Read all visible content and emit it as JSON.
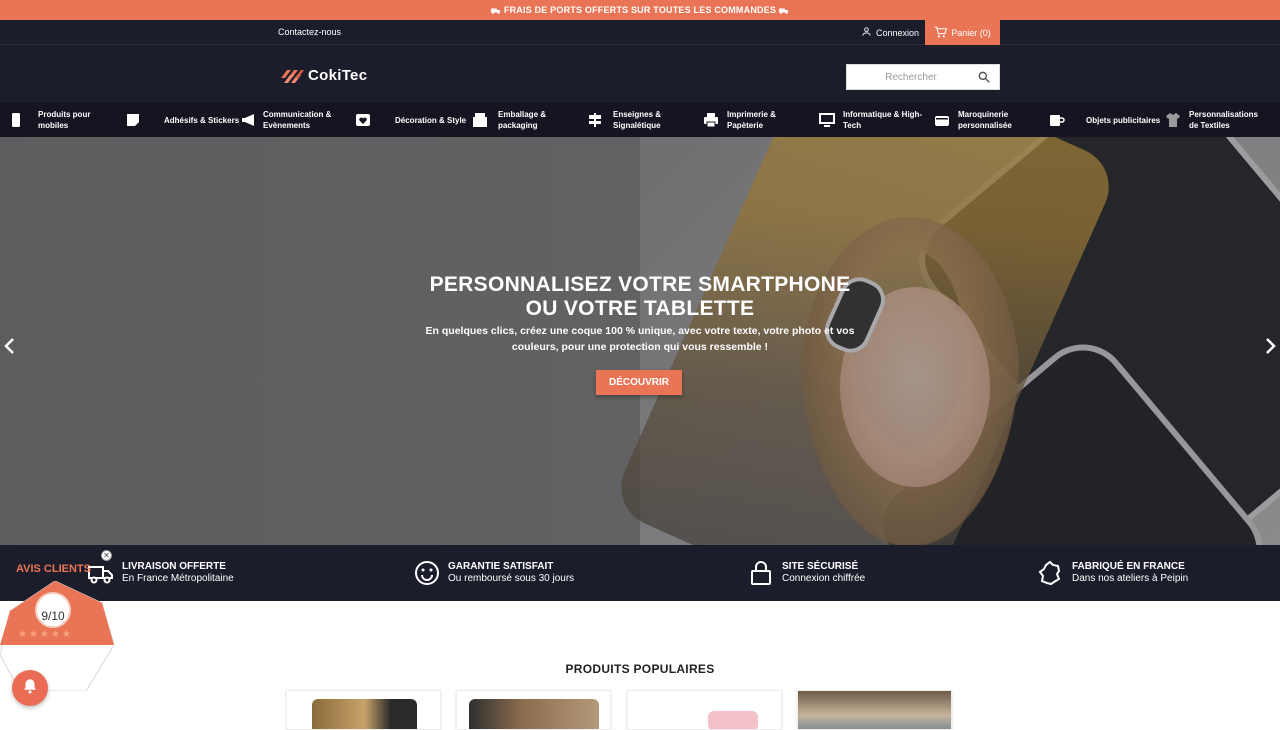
{
  "promo": {
    "text": "FRAIS DE PORTS OFFERTS SUR TOUTES LES COMMANDES"
  },
  "topbar": {
    "contact": "Contactez-nous",
    "login": "Connexion",
    "cart": "Panier (0)"
  },
  "header": {
    "logo_text": "CokiTec",
    "search_placeholder": "Rechercher"
  },
  "nav": {
    "items": [
      {
        "label": "Produits pour mobiles",
        "icon": "phone-icon"
      },
      {
        "label": "Adhésifs & Stickers",
        "icon": "sticker-icon"
      },
      {
        "label": "Communication & Evènements",
        "icon": "megaphone-icon"
      },
      {
        "label": "Décoration & Style",
        "icon": "heart-icon"
      },
      {
        "label": "Emballage & packaging",
        "icon": "box-icon"
      },
      {
        "label": "Enseignes & Signalétique",
        "icon": "signpost-icon"
      },
      {
        "label": "Imprimerie & Papèterie",
        "icon": "printer-icon"
      },
      {
        "label": "Informatique & High-Tech",
        "icon": "monitor-icon"
      },
      {
        "label": "Maroquinerie personnalisée",
        "icon": "wallet-icon"
      },
      {
        "label": "Objets publicitaires",
        "icon": "mug-icon"
      },
      {
        "label": "Personnalisations de Textiles",
        "icon": "tshirt-icon"
      }
    ]
  },
  "hero": {
    "title_line1": "PERSONNALISEZ VOTRE SMARTPHONE",
    "title_line2": "OU VOTRE TABLETTE",
    "text": "En quelques clics, créez une coque 100 % unique, avec votre texte, votre photo et vos couleurs, pour une protection qui vous ressemble !",
    "button": "DÉCOUVRIR"
  },
  "features": [
    {
      "title": "LIVRAISON OFFERTE",
      "subtitle": "En France Métropolitaine",
      "icon": "truck-icon"
    },
    {
      "title": "GARANTIE SATISFAIT",
      "subtitle": "Ou remboursé sous 30 jours",
      "icon": "smiley-icon"
    },
    {
      "title": "SITE SÉCURISÉ",
      "subtitle": "Connexion chiffrée",
      "icon": "lock-icon"
    },
    {
      "title": "FABRIQUÉ EN FRANCE",
      "subtitle": "Dans nos ateliers à Peipin",
      "icon": "france-map-icon"
    }
  ],
  "products_section": {
    "title": "PRODUITS POPULAIRES"
  },
  "reviews_widget": {
    "title": "AVIS CLIENTS",
    "score": "9/10",
    "stars": 5
  },
  "colors": {
    "accent": "#ea7556",
    "dark": "#1c1d2b",
    "nav_dark": "#141520"
  }
}
